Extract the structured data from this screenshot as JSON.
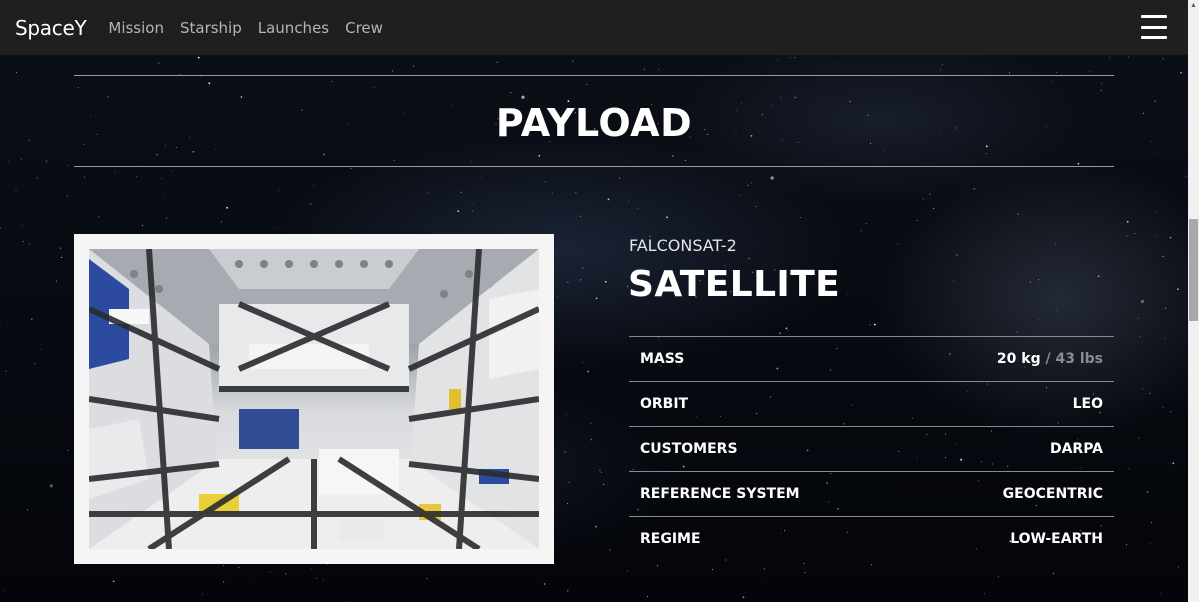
{
  "navbar": {
    "brand": "SpaceY",
    "links": [
      "Mission",
      "Starship",
      "Launches",
      "Crew"
    ],
    "menu_icon": "hamburger-icon"
  },
  "section": {
    "title": "PAYLOAD"
  },
  "payload": {
    "id": "FALCONSAT-2",
    "type": "SATELLITE",
    "image_icon": "cargo-bay-photo"
  },
  "specs": [
    {
      "label": "MASS",
      "value": "20 kg",
      "separator": "/",
      "alt_value": "43 lbs"
    },
    {
      "label": "ORBIT",
      "value": "LEO"
    },
    {
      "label": "CUSTOMERS",
      "value": "DARPA"
    },
    {
      "label": "REFERENCE SYSTEM",
      "value": "GEOCENTRIC"
    },
    {
      "label": "REGIME",
      "value": "LOW-EARTH"
    }
  ],
  "colors": {
    "navbar_bg": "#1f1f1f",
    "nav_link": "#b5b5b5",
    "muted_value": "#8c8c8c",
    "photo_frame": "#f5f5f5"
  }
}
